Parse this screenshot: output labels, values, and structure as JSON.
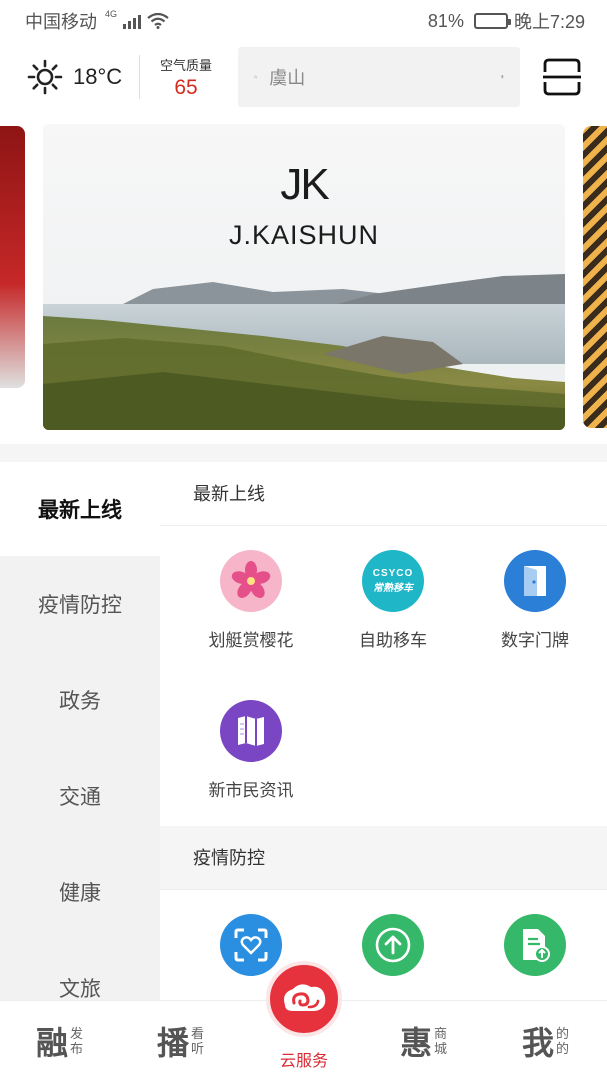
{
  "status_bar": {
    "carrier": "中国移动",
    "network": "4G",
    "battery": "81%",
    "battery_level": 0.81,
    "time": "晚上7:29"
  },
  "header": {
    "temperature": "18°C",
    "air_quality_label": "空气质量",
    "air_quality_value": "65",
    "search_value": "虞山",
    "icons": [
      "sun-icon",
      "search-icon",
      "microphone-icon",
      "scan-icon"
    ]
  },
  "banner": {
    "logo_text": "JK",
    "brand_name": "J.KAISHUN"
  },
  "categories": [
    {
      "label": "最新上线",
      "active": true
    },
    {
      "label": "疫情防控",
      "active": false
    },
    {
      "label": "政务",
      "active": false
    },
    {
      "label": "交通",
      "active": false
    },
    {
      "label": "健康",
      "active": false
    },
    {
      "label": "文旅",
      "active": false
    }
  ],
  "sections": [
    {
      "title": "最新上线",
      "items": [
        {
          "label": "划艇赏樱花",
          "icon": "cherry-blossom-icon"
        },
        {
          "label": "自助移车",
          "icon": "car-move-icon",
          "icon_text": "CSYCO",
          "icon_subtext": "常熟移车"
        },
        {
          "label": "数字门牌",
          "icon": "door-plate-icon"
        },
        {
          "label": "新市民资讯",
          "icon": "map-book-icon"
        }
      ]
    },
    {
      "title": "疫情防控",
      "items": [
        {
          "label": "",
          "icon": "health-scan-icon"
        },
        {
          "label": "",
          "icon": "upload-arrow-icon"
        },
        {
          "label": "",
          "icon": "document-upload-icon"
        }
      ]
    }
  ],
  "tabbar": {
    "tabs": [
      {
        "big": "融",
        "small_top": "发",
        "small_bottom": "布"
      },
      {
        "big": "播",
        "small_top": "看",
        "small_bottom": "听"
      },
      {
        "big": "惠",
        "small_top": "商",
        "small_bottom": "城"
      },
      {
        "big": "我",
        "small_top": "的",
        "small_bottom": "的"
      }
    ],
    "center_label": "云服务"
  },
  "colors": {
    "accent_red": "#e5323c",
    "air_quality_red": "#d42b20"
  }
}
